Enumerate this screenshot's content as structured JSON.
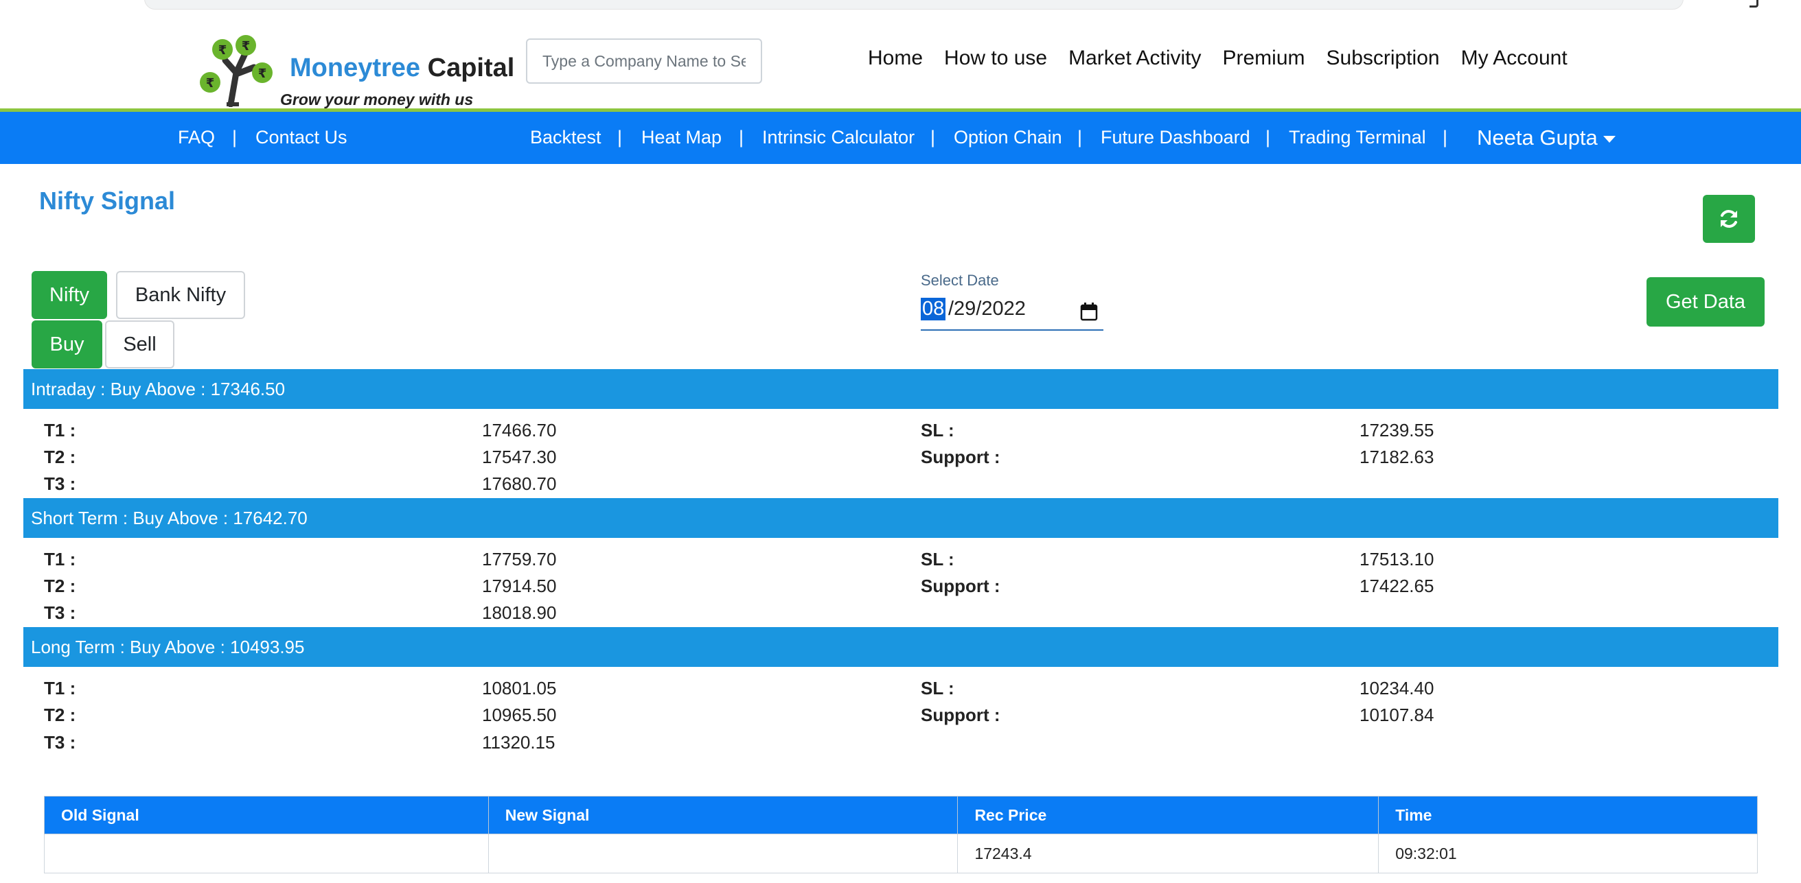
{
  "header": {
    "brand_part1": "Moneytree",
    "brand_part2": "Capital",
    "tagline": "Grow your money with us",
    "search_placeholder": "Type a Company Name to Search",
    "nav": [
      "Home",
      "How to use",
      "Market Activity",
      "Premium",
      "Subscription",
      "My Account"
    ]
  },
  "subnav": {
    "left": [
      "FAQ",
      "Contact Us"
    ],
    "center": [
      "Backtest",
      "Heat Map",
      "Intrinsic Calculator",
      "Option Chain",
      "Future Dashboard",
      "Trading Terminal"
    ],
    "separator": "|",
    "user_name": "Neeta Gupta"
  },
  "page": {
    "title": "Nifty Signal",
    "index_buttons": [
      "Nifty",
      "Bank Nifty"
    ],
    "side_buttons": [
      "Buy",
      "Sell"
    ],
    "date_label": "Select Date",
    "date_month": "08",
    "date_rest": "/29/2022",
    "get_data_label": "Get Data"
  },
  "sections": [
    {
      "title": "Intraday : Buy Above : 17346.50",
      "t1_label": "T1 :",
      "t1": "17466.70",
      "t2_label": "T2 :",
      "t2": "17547.30",
      "t3_label": "T3 :",
      "t3": "17680.70",
      "sl_label": "SL :",
      "sl": "17239.55",
      "support_label": "Support :",
      "support": "17182.63"
    },
    {
      "title": "Short Term : Buy Above : 17642.70",
      "t1_label": "T1 :",
      "t1": "17759.70",
      "t2_label": "T2 :",
      "t2": "17914.50",
      "t3_label": "T3 :",
      "t3": "18018.90",
      "sl_label": "SL :",
      "sl": "17513.10",
      "support_label": "Support :",
      "support": "17422.65"
    },
    {
      "title": "Long Term : Buy Above : 10493.95",
      "t1_label": "T1 :",
      "t1": "10801.05",
      "t2_label": "T2 :",
      "t2": "10965.50",
      "t3_label": "T3 :",
      "t3": "11320.15",
      "sl_label": "SL :",
      "sl": "10234.40",
      "support_label": "Support :",
      "support": "10107.84"
    }
  ],
  "signal_table": {
    "headers": [
      "Old Signal",
      "New Signal",
      "Rec Price",
      "Time"
    ],
    "rows": [
      [
        "",
        "",
        "17243.4",
        "09:32:01"
      ]
    ]
  },
  "colors": {
    "brand_blue": "#2c8ad6",
    "nav_blue": "#0a7cf5",
    "section_blue": "#1a96e0",
    "green": "#28a745",
    "accent_green": "#8dc63f"
  },
  "icons": {
    "refresh": "refresh-icon",
    "calendar": "calendar-icon",
    "dropdown": "caret-down-icon",
    "logo": "money-tree-icon"
  }
}
